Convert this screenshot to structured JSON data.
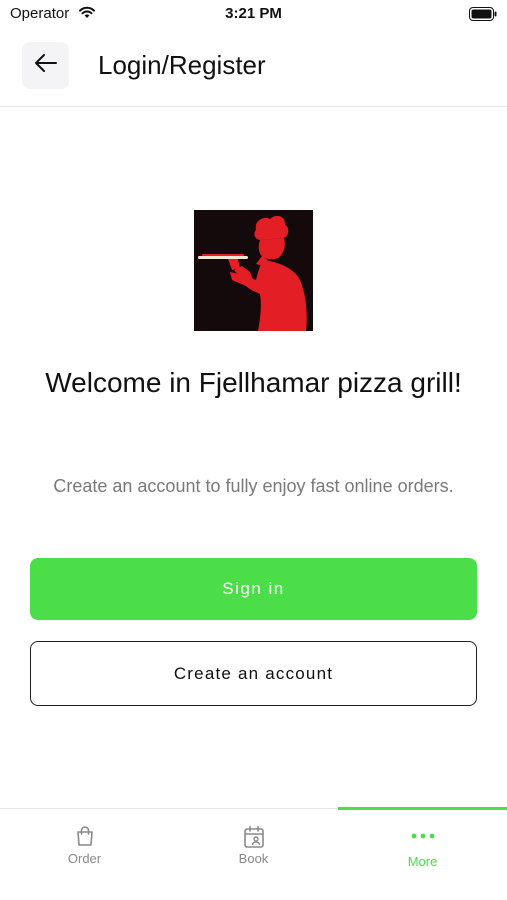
{
  "status_bar": {
    "carrier": "Operator",
    "time": "3:21 PM"
  },
  "header": {
    "title": "Login/Register",
    "back_icon": "arrow-left-icon"
  },
  "logo": {
    "description_icon": "pizza-chef-logo",
    "background_color": "#14090b",
    "figure_color": "#e31e24"
  },
  "main": {
    "welcome_title": "Welcome in Fjellhamar pizza grill!",
    "subtitle": "Create an account to fully enjoy fast online orders.",
    "signin_label": "Sign in",
    "create_account_label": "Create an account"
  },
  "tab_bar": {
    "active_color": "#4bde49",
    "tabs": [
      {
        "label": "Order",
        "icon": "shopping-bag-icon",
        "active": false
      },
      {
        "label": "Book",
        "icon": "calendar-person-icon",
        "active": false
      },
      {
        "label": "More",
        "icon": "more-dots-icon",
        "active": true
      }
    ]
  }
}
